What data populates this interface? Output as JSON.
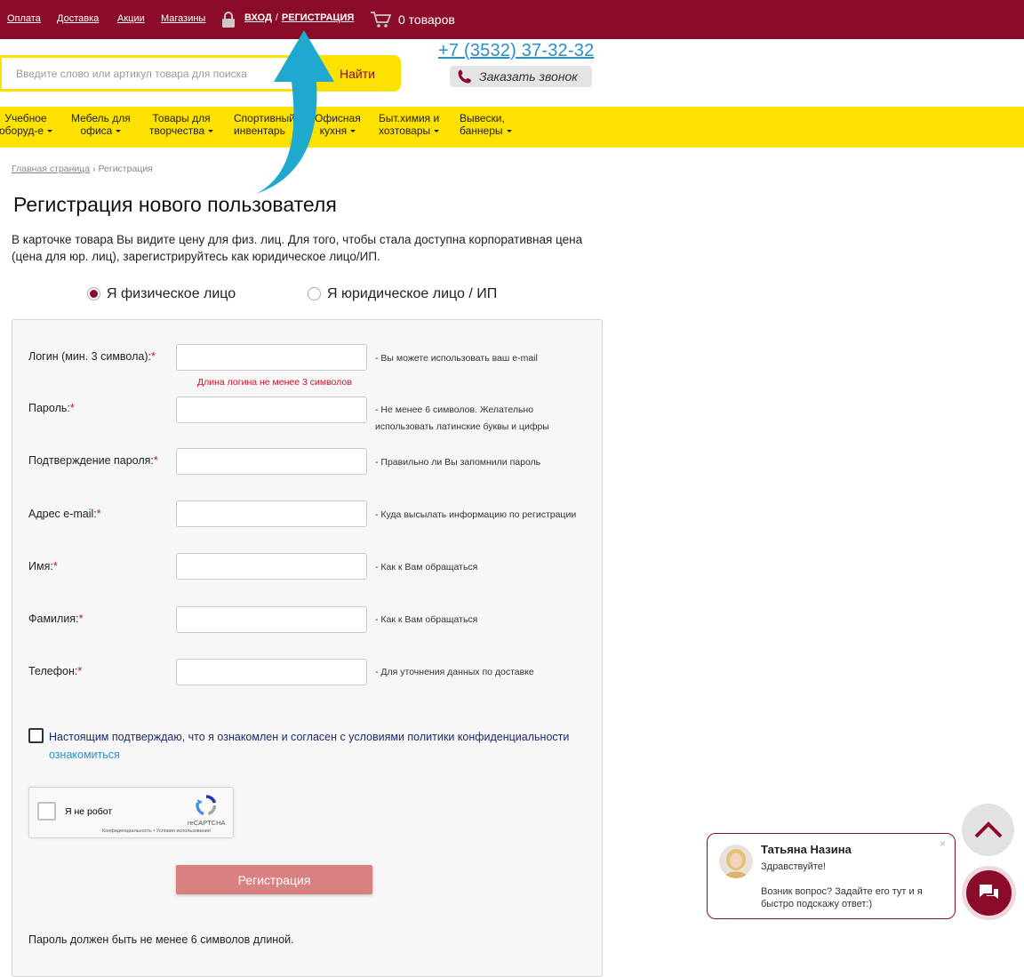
{
  "topbar": {
    "links": [
      "Оплата",
      "Доставка",
      "Акции",
      "Магазины"
    ],
    "login": "ВХОД",
    "separator": "/",
    "register": "РЕГИСТРАЦИЯ",
    "cart": "0 товаров"
  },
  "search": {
    "placeholder": "Введите слово или артикул товара для поиска",
    "button": "Найти"
  },
  "phone": "+7 (3532) 37-32-32",
  "callback": "Заказать звонок",
  "menu": [
    [
      "Учебное",
      "оборуд-е"
    ],
    [
      "Мебель для",
      "офиса"
    ],
    [
      "Товары для",
      "творчества"
    ],
    [
      "Спортивный",
      "инвентарь"
    ],
    [
      "Офисная",
      "кухня"
    ],
    [
      "Быт.химия и",
      "хозтовары"
    ],
    [
      "Вывески,",
      "баннеры"
    ]
  ],
  "breadcrumb": {
    "home": "Главная страница",
    "sep": "›",
    "current": "Регистрация"
  },
  "page": {
    "title": "Регистрация нового пользователя",
    "intro": "В  карточке товара Вы видите цену для физ. лиц. Для того, чтобы стала доступна корпоративная цена (цена для юр. лиц), зарегистрируйтесь как юридическое лицо/ИП."
  },
  "account_type": {
    "individual": "Я физическое лицо",
    "company": "Я юридическое лицо / ИП",
    "selected": "individual"
  },
  "form": {
    "fields": [
      {
        "label": "Логин (мин. 3 символа):",
        "req": "*",
        "hint": "- Вы можете использовать ваш e-mail"
      },
      {
        "label": "Пароль:",
        "req": "*",
        "hint": "- Не менее 6 символов. Желательно использовать латинские буквы и цифры"
      },
      {
        "label": "Подтверждение пароля:",
        "req": "*",
        "hint": "- Правильно ли Вы запомнили пароль"
      },
      {
        "label": "Адрес e-mail:",
        "req": "*",
        "hint": "- Куда высылать информацию по регистрации"
      },
      {
        "label": "Имя:",
        "req": "*",
        "hint": "- Как к Вам обращаться"
      },
      {
        "label": "Фамилия:",
        "req": "*",
        "hint": "- Как к Вам обращаться"
      },
      {
        "label": "Телефон:",
        "req": "*",
        "hint": "- Для уточнения данных по доставке"
      }
    ],
    "login_error": "Длина логина не менее 3 символов",
    "consent": "Настоящим подтверждаю, что я ознакомлен и согласен с условиями политики конфиденциальности",
    "consent_link": "ознакомиться",
    "captcha": {
      "label": "Я не робот",
      "brand": "reCAPTCHA",
      "links": "Конфиденциальность • Условия использования"
    },
    "submit": "Регистрация",
    "password_note": "Пароль должен быть не менее 6 символов длиной."
  },
  "chat": {
    "name": "Татьяна Назина",
    "greeting": "Здравствуйте!",
    "message": "Возник вопрос? Задайте его тут и я быстро подскажу ответ:)",
    "close": "×"
  },
  "colors": {
    "brand": "#8b0c2a",
    "accent_yellow": "#fde100",
    "link": "#2a8fc7",
    "annotation_arrow": "#1fa9cf"
  }
}
